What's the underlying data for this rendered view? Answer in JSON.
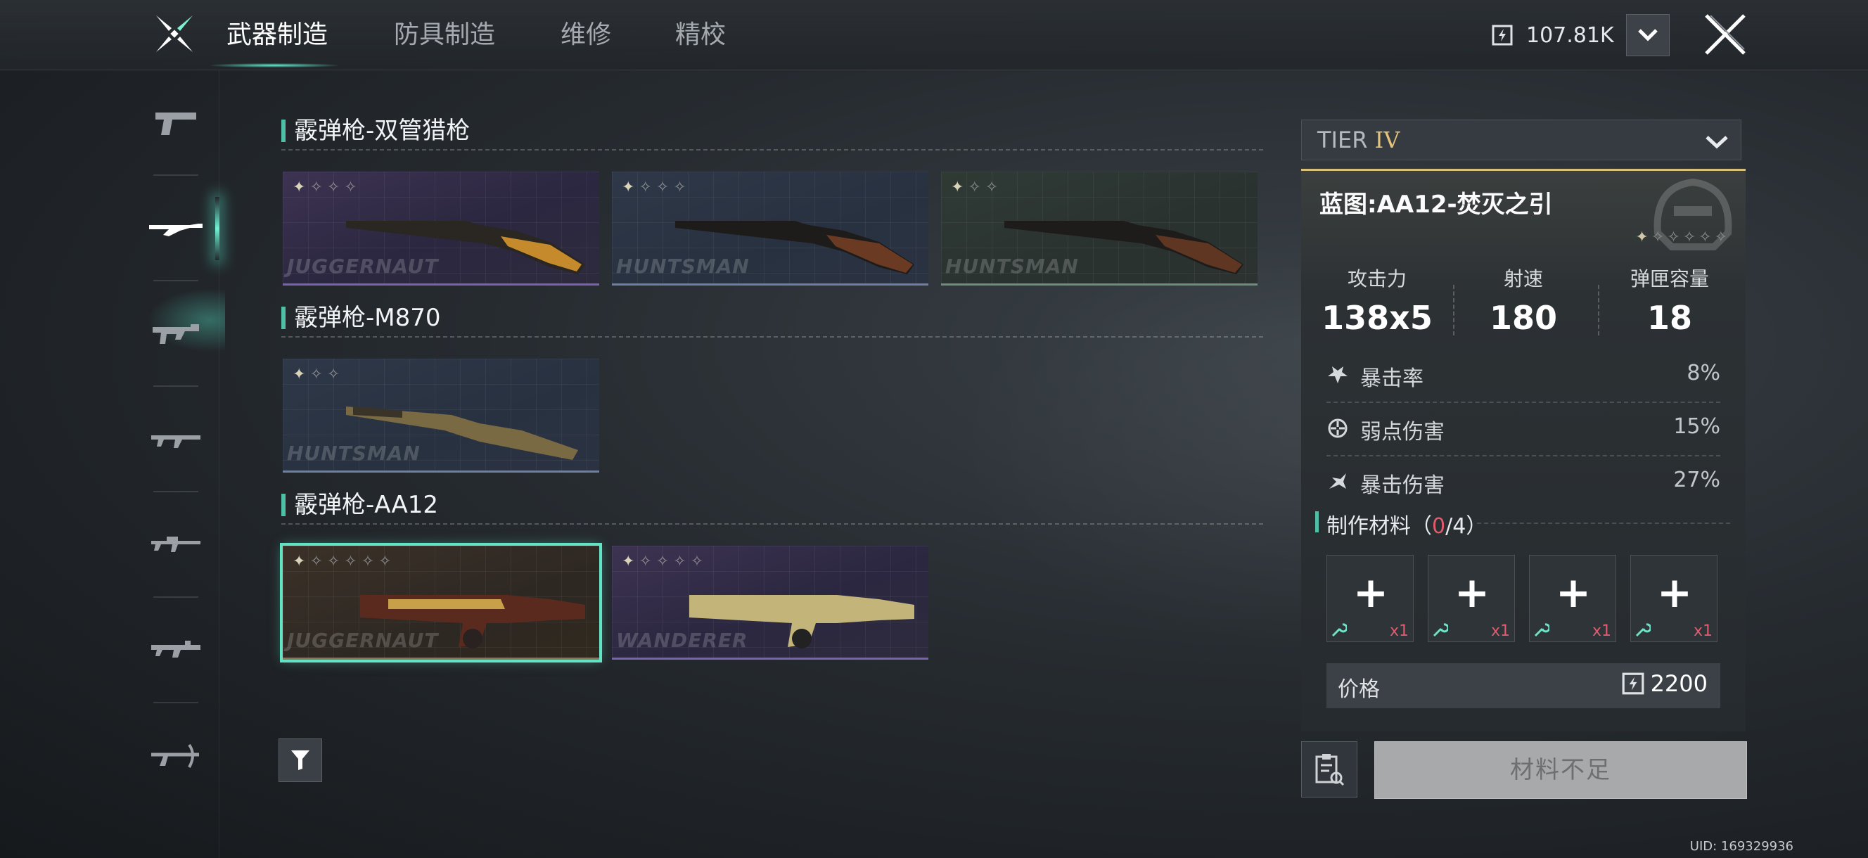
{
  "header": {
    "tabs": [
      {
        "label": "武器制造",
        "active": true
      },
      {
        "label": "防具制造",
        "active": false
      },
      {
        "label": "维修",
        "active": false
      },
      {
        "label": "精校",
        "active": false
      }
    ],
    "currency_amount": "107.81K"
  },
  "left_nav": {
    "items": [
      {
        "icon": "pistol-icon"
      },
      {
        "icon": "shotgun-icon",
        "active": true
      },
      {
        "icon": "smg-icon"
      },
      {
        "icon": "assault-rifle-icon"
      },
      {
        "icon": "rifle-icon"
      },
      {
        "icon": "lmg-icon"
      },
      {
        "icon": "crossbow-icon"
      }
    ]
  },
  "sections": [
    {
      "title": "霰弹枪-双管猎枪",
      "cards": [
        {
          "brand": "JUGGERNAUT",
          "stars": 4,
          "max_stars": 4,
          "theme": "purple"
        },
        {
          "brand": "HUNTSMAN",
          "stars": 4,
          "max_stars": 4,
          "theme": "blue"
        },
        {
          "brand": "HUNTSMAN",
          "stars": 3,
          "max_stars": 3,
          "theme": "green"
        }
      ]
    },
    {
      "title": "霰弹枪-M870",
      "cards": [
        {
          "brand": "HUNTSMAN",
          "stars": 3,
          "max_stars": 3,
          "theme": "blue"
        }
      ]
    },
    {
      "title": "霰弹枪-AA12",
      "cards": [
        {
          "brand": "JUGGERNAUT",
          "stars": 6,
          "max_stars": 6,
          "theme": "brown",
          "selected": true
        },
        {
          "brand": "WANDERER",
          "stars": 5,
          "max_stars": 5,
          "theme": "purple"
        }
      ]
    }
  ],
  "detail": {
    "tier_label": "TIER",
    "tier_roman": "IV",
    "blueprint_name": "蓝图:AA12-焚灭之引",
    "stars": 6,
    "stats": [
      {
        "label": "攻击力",
        "value": "138x5"
      },
      {
        "label": "射速",
        "value": "180"
      },
      {
        "label": "弹匣容量",
        "value": "18"
      }
    ],
    "sub_stats": [
      {
        "icon": "crit-rate-icon",
        "label": "暴击率",
        "value": "8%"
      },
      {
        "icon": "weakpoint-icon",
        "label": "弱点伤害",
        "value": "15%"
      },
      {
        "icon": "crit-damage-icon",
        "label": "暴击伤害",
        "value": "27%"
      }
    ],
    "materials": {
      "label": "制作材料",
      "open": "（",
      "have": "0",
      "sep": "/",
      "need": "4",
      "close": "）",
      "slots": [
        {
          "qty": "x1"
        },
        {
          "qty": "x1"
        },
        {
          "qty": "x1"
        },
        {
          "qty": "x1"
        }
      ]
    },
    "price_label": "价格",
    "price_value": "2200"
  },
  "craft_button": "材料不足",
  "uid": "UID: 169329936",
  "colors": {
    "accent": "#4fc0a6",
    "highlight": "#62e3c4",
    "warning": "#e25a6e",
    "tier_gold": "#e3c27a"
  }
}
